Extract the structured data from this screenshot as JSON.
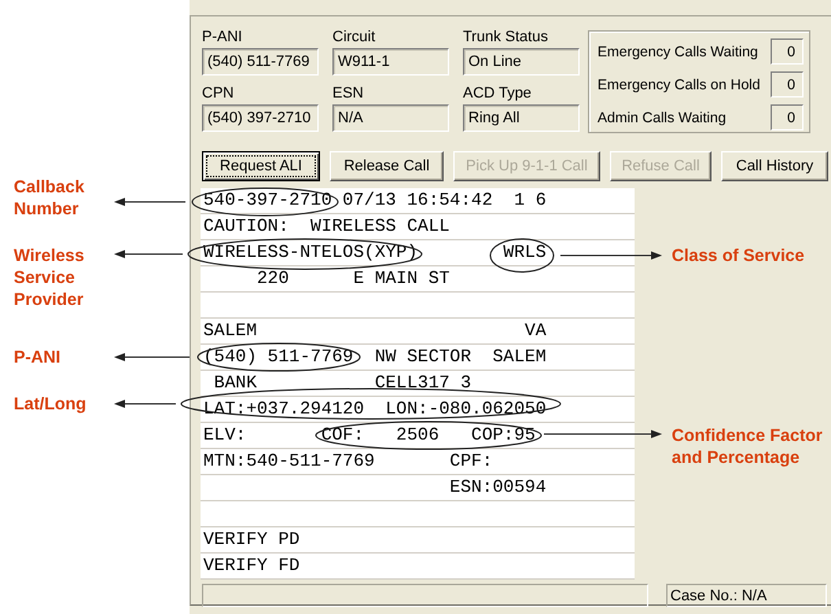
{
  "fields": [
    {
      "label": "P-ANI",
      "value": "(540) 511-7769"
    },
    {
      "label": "Circuit",
      "value": "W911-1"
    },
    {
      "label": "Trunk Status",
      "value": "On Line"
    },
    {
      "label": "CPN",
      "value": "(540) 397-2710"
    },
    {
      "label": "ESN",
      "value": "N/A"
    },
    {
      "label": "ACD Type",
      "value": "Ring All"
    }
  ],
  "counters": [
    {
      "label": "Emergency Calls Waiting",
      "value": "0"
    },
    {
      "label": "Emergency Calls on Hold",
      "value": "0"
    },
    {
      "label": "Admin Calls Waiting",
      "value": "0"
    }
  ],
  "buttons": [
    {
      "label": "Request ALI",
      "disabled": false,
      "focused": true
    },
    {
      "label": "Release Call",
      "disabled": false,
      "focused": false
    },
    {
      "label": "Pick Up 9-1-1 Call",
      "disabled": true,
      "focused": false
    },
    {
      "label": "Refuse Call",
      "disabled": true,
      "focused": false
    },
    {
      "label": "Call History",
      "disabled": false,
      "focused": false
    }
  ],
  "ali_lines": [
    {
      "kind": "text",
      "text": "540-397-2710 07/13 16:54:42  1 6"
    },
    {
      "kind": "text",
      "text": "CAUTION:  WIRELESS CALL"
    },
    {
      "kind": "text",
      "text": "WIRELESS-NTELOS(XYP)        WRLS"
    },
    {
      "kind": "text",
      "text": "     220      E MAIN ST"
    },
    {
      "kind": "blank"
    },
    {
      "kind": "text",
      "text": "SALEM                         VA"
    },
    {
      "kind": "text",
      "text": "(540) 511-7769  NW SECTOR  SALEM"
    },
    {
      "kind": "text",
      "text": " BANK           CELL317 3"
    },
    {
      "kind": "text",
      "text": "LAT:+037.294120  LON:-080.062050"
    },
    {
      "kind": "text",
      "text": "ELV:       COF:   2506   COP:95"
    },
    {
      "kind": "text",
      "text": "MTN:540-511-7769       CPF:"
    },
    {
      "kind": "text",
      "text": "                       ESN:00594"
    },
    {
      "kind": "blank"
    },
    {
      "kind": "text",
      "text": "VERIFY PD"
    },
    {
      "kind": "text",
      "text": "VERIFY FD"
    }
  ],
  "status_bar": {
    "case": "Case No.: N/A"
  },
  "annotations": [
    {
      "label": "Callback Number",
      "kind": "left"
    },
    {
      "label": "Wireless Service Provider",
      "kind": "left"
    },
    {
      "label": "Class of Service",
      "kind": "right"
    },
    {
      "label": "P-ANI",
      "kind": "left"
    },
    {
      "label": "Lat/Long",
      "kind": "left"
    },
    {
      "label": "Confidence Factor and Percentage",
      "kind": "right"
    }
  ]
}
